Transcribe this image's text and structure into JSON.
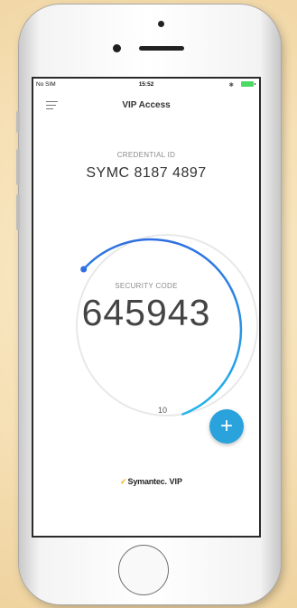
{
  "status_bar": {
    "carrier": "No SIM",
    "time": "15:52",
    "bluetooth": "✱"
  },
  "nav": {
    "title": "VIP Access"
  },
  "credential": {
    "label": "CREDENTIAL ID",
    "value": "SYMC 8187 4897"
  },
  "security": {
    "label": "SECURITY CODE",
    "code": "645943",
    "seconds_remaining": "10"
  },
  "brand": {
    "check": "✓",
    "name": "Symantec",
    "suffix": "VIP"
  },
  "fab": {
    "label": "+"
  },
  "colors": {
    "ring_blue": "#2f6fe0",
    "ring_cyan": "#21b5ea",
    "fab": "#2aa3dd",
    "background": "#f5dfb4"
  }
}
